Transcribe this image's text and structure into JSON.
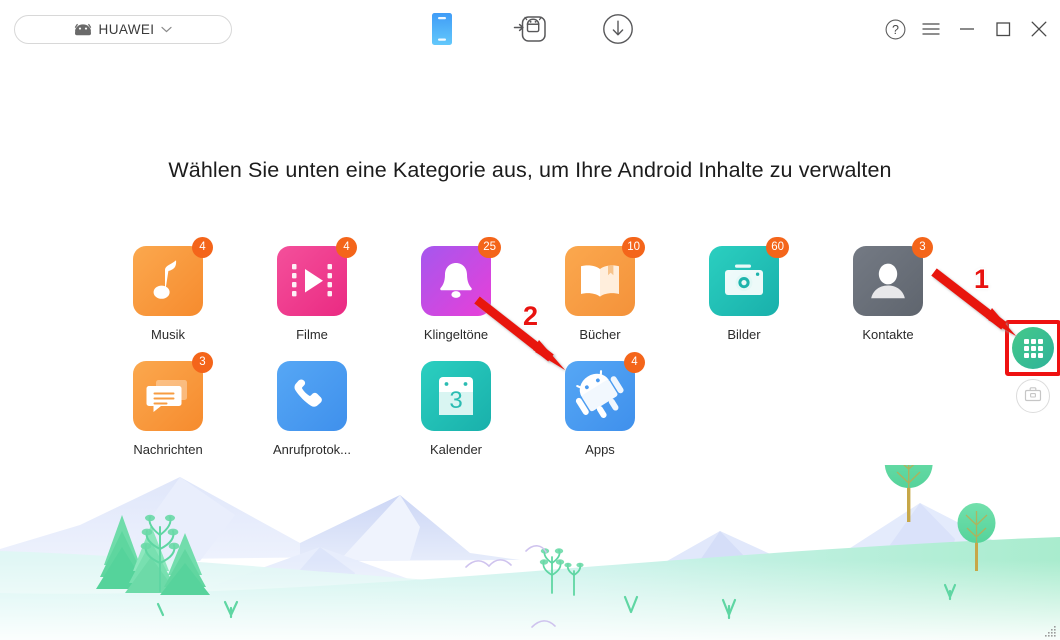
{
  "window": {
    "device_selector": {
      "name": "HUAWEI",
      "icon": "android-head-icon",
      "chevron": "chevron-down-icon"
    },
    "toolbar": [
      {
        "id": "phone",
        "icon": "phone-device-icon",
        "active": true
      },
      {
        "id": "transfer",
        "icon": "android-transfer-icon",
        "active": false
      },
      {
        "id": "download",
        "icon": "download-circle-icon",
        "active": false
      }
    ],
    "controls": [
      {
        "id": "help",
        "icon": "help-circle-icon",
        "label": "?"
      },
      {
        "id": "menu",
        "icon": "hamburger-menu-icon",
        "label": ""
      },
      {
        "id": "minimize",
        "icon": "minimize-icon",
        "label": ""
      },
      {
        "id": "maximize",
        "icon": "maximize-icon",
        "label": ""
      },
      {
        "id": "close",
        "icon": "close-icon",
        "label": ""
      }
    ]
  },
  "main": {
    "headline": "Wählen Sie unten eine Kategorie aus, um Ihre Android Inhalte zu verwalten",
    "categories_row1": [
      {
        "label": "Musik",
        "badge": "4",
        "icon": "music-note-icon",
        "color": "#f79c42"
      },
      {
        "label": "Filme",
        "badge": "4",
        "icon": "film-play-icon",
        "color": "#ef3d8f"
      },
      {
        "label": "Klingeltöne",
        "badge": "25",
        "icon": "bell-icon",
        "color": "#b24ae8"
      },
      {
        "label": "Bücher",
        "badge": "10",
        "icon": "open-book-icon",
        "color": "#f49b3c"
      },
      {
        "label": "Bilder",
        "badge": "60",
        "icon": "camera-icon",
        "color": "#24bdb4"
      },
      {
        "label": "Kontakte",
        "badge": "3",
        "icon": "person-icon",
        "color": "#6b7079"
      }
    ],
    "categories_row2": [
      {
        "label": "Nachrichten",
        "badge": "3",
        "icon": "message-bubble-icon",
        "color": "#f79c42"
      },
      {
        "label": "Anrufprotok...",
        "badge": "",
        "icon": "phone-handset-icon",
        "color": "#4a9af0"
      },
      {
        "label": "Kalender",
        "badge": "",
        "icon": "calendar-icon",
        "color": "#24bdb4",
        "day": "3"
      },
      {
        "label": "Apps",
        "badge": "4",
        "icon": "android-robot-icon",
        "color": "#4a9af0"
      }
    ]
  },
  "side_actions": {
    "apps_grid_button": {
      "icon": "grid-apps-icon",
      "color": "#3cc28d",
      "highlighted": true
    },
    "toolbox_button": {
      "icon": "toolbox-icon",
      "color": "#cfcfcf"
    }
  },
  "annotations": [
    {
      "number": "1",
      "target": "apps-grid-button"
    },
    {
      "number": "2",
      "target": "apps-category-tile"
    }
  ],
  "colors": {
    "badge": "#f4651a",
    "annotation_red": "#e8120f",
    "highlight_border": "#ee1111",
    "green_accent": "#3cc28d",
    "headline_text": "#1c1c1c"
  }
}
